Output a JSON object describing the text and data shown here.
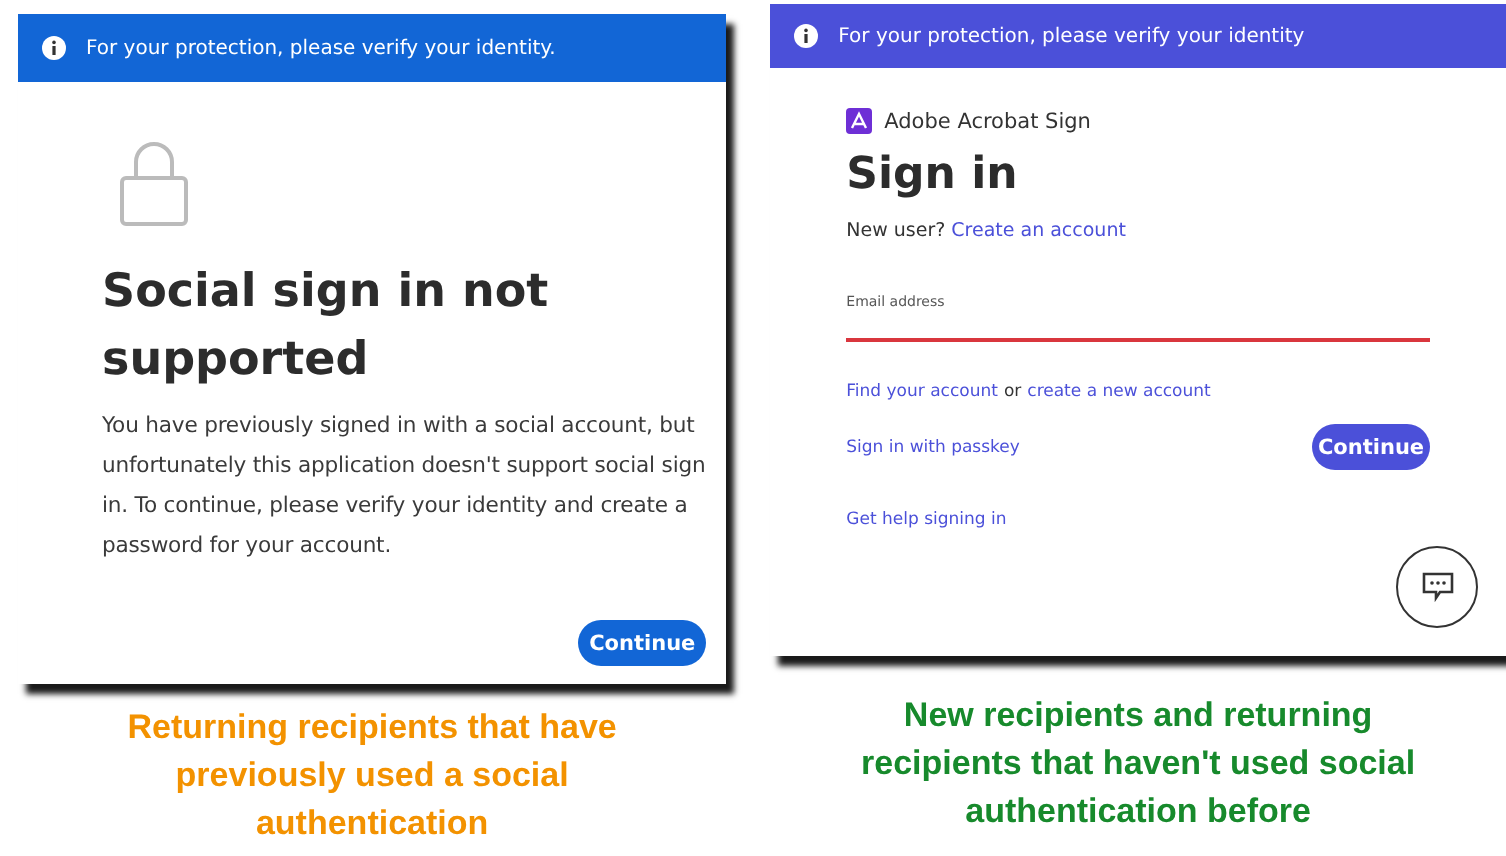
{
  "left_panel": {
    "banner": "For your protection, please verify your identity.",
    "title": "Social sign in not supported",
    "message": "You have previously signed in with a social account, but unfortunately this application doesn't support social sign in. To continue, please verify your identity and create a password for your account.",
    "button": "Continue"
  },
  "right_panel": {
    "banner": "For your protection, please verify your identity",
    "brand": "Adobe Acrobat Sign",
    "title": "Sign in",
    "new_user": {
      "prompt": "New user?",
      "link": "Create an account"
    },
    "email": {
      "placeholder": "Email address"
    },
    "find_account": {
      "link": "Find your account",
      "joiner": "or",
      "second_link": "create a new account"
    },
    "passkey_link": "Sign in with passkey",
    "button": "Continue",
    "help_link": "Get help signing in"
  },
  "captions": [
    {
      "text": "Returning recipients that have previously used a social authentication",
      "color": "#f39200"
    },
    {
      "text": "New recipients and returning recipients that haven't used social authentication before",
      "color": "#178a2c"
    }
  ]
}
